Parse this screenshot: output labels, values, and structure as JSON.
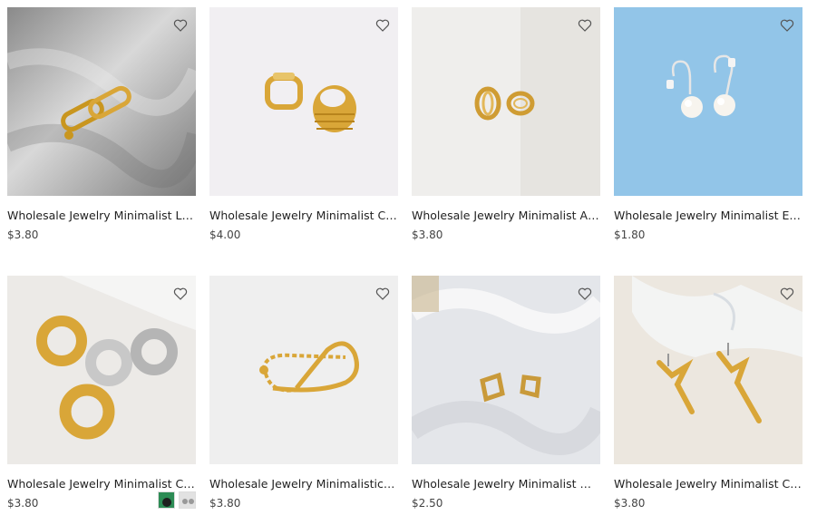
{
  "products": [
    {
      "title": "Wholesale Jewelry Minimalist Link C...",
      "price": "$3.80"
    },
    {
      "title": "Wholesale Jewelry Minimalist Chun...",
      "price": "$4.00"
    },
    {
      "title": "Wholesale Jewelry Minimalist Anniv...",
      "price": "$3.80"
    },
    {
      "title": "Wholesale Jewelry Minimalist Elega...",
      "price": "$1.80"
    },
    {
      "title": "Wholesale Jewelry Minimalist Circul...",
      "price": "$3.80"
    },
    {
      "title": "Wholesale Jewelry Minimalistic Gold...",
      "price": "$3.80"
    },
    {
      "title": "Wholesale Jewelry Minimalist Matte...",
      "price": "$2.50"
    },
    {
      "title": "Wholesale Jewelry Minimalist Chic ...",
      "price": "$3.80"
    }
  ],
  "colors": {
    "gold": "#d9a638",
    "heart": "#555555",
    "text": "#222222",
    "price": "#444444"
  }
}
